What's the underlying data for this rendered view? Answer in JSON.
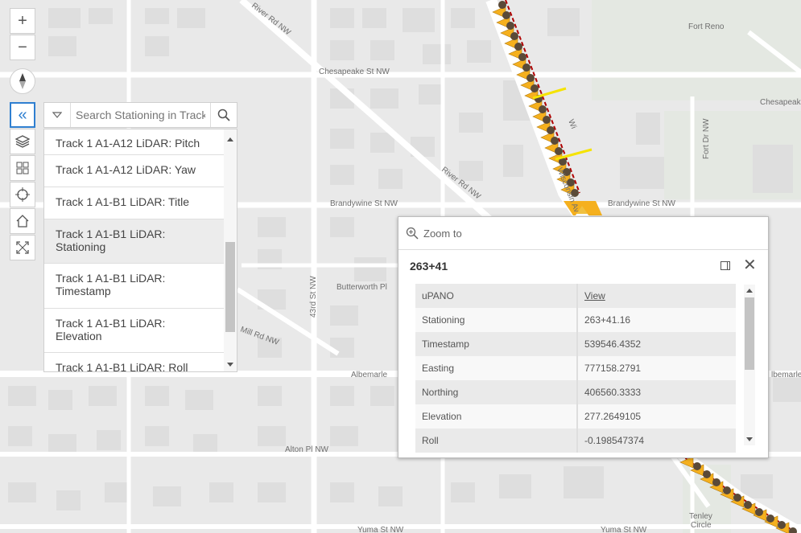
{
  "map": {
    "labels": {
      "river_rd_top": "River Rd NW",
      "chesapeake_left": "Chesapeake St NW",
      "chesapeake_right": "Chesapeak",
      "fort_reno": "Fort Reno",
      "fort_dr": "Fort Dr NW",
      "river_rd_mid": "River Rd NW",
      "brandywine_left": "Brandywine St NW",
      "brandywine_right": "Brandywine St NW",
      "wisconsin_a": "Wi",
      "wisconsin_b": "Wisconsin Av",
      "butterworth": "Butterworth Pl",
      "forty_third": "43rd St NW",
      "mill_rd": "Mill Rd NW",
      "albemarle_left": "Albemarle",
      "albemarle_right": "lbemarle",
      "alton": "Alton Pl NW",
      "tenley_a": "Tenley",
      "tenley_b": "Circle",
      "yuma_left": "Yuma St NW",
      "yuma_right": "Yuma St NW"
    },
    "colors": {
      "background": "#e9e9e9",
      "road": "#ffffff",
      "building": "#dcdcdc",
      "park": "#e2e8e0",
      "track_marker": "#f5b01e",
      "track_line": "#b00000",
      "highlight": "#f5e300"
    }
  },
  "controls": {
    "zoom_in": "+",
    "zoom_out": "−",
    "compass_icon": "compass-icon",
    "collapse_icon": "«",
    "layers_icon": "layers-icon",
    "basemap_icon": "basemap-gallery-icon",
    "locate_icon": "locate-icon",
    "home_icon": "home-icon",
    "fullscreen_icon": "fullscreen-icon"
  },
  "search": {
    "placeholder": "Search Stationing in Track",
    "suggestions": [
      "Track 1 A1-A12 LiDAR: Pitch",
      "Track 1 A1-A12 LiDAR: Yaw",
      "Track 1 A1-B1 LiDAR: Title",
      "Track 1 A1-B1 LiDAR: Stationing",
      "Track 1 A1-B1 LiDAR: Timestamp",
      "Track 1 A1-B1 LiDAR: Elevation",
      "Track 1 A1-B1 LiDAR: Roll"
    ]
  },
  "popup": {
    "zoom_to": "Zoom to",
    "title": "263+41",
    "rows": [
      {
        "key": "uPANO",
        "value": "View"
      },
      {
        "key": "Stationing",
        "value": "263+41.16"
      },
      {
        "key": "Timestamp",
        "value": "539546.4352"
      },
      {
        "key": "Easting",
        "value": "777158.2791"
      },
      {
        "key": "Northing",
        "value": "406560.3333"
      },
      {
        "key": "Elevation",
        "value": "277.2649105"
      },
      {
        "key": "Roll",
        "value": "-0.198547374"
      }
    ]
  }
}
